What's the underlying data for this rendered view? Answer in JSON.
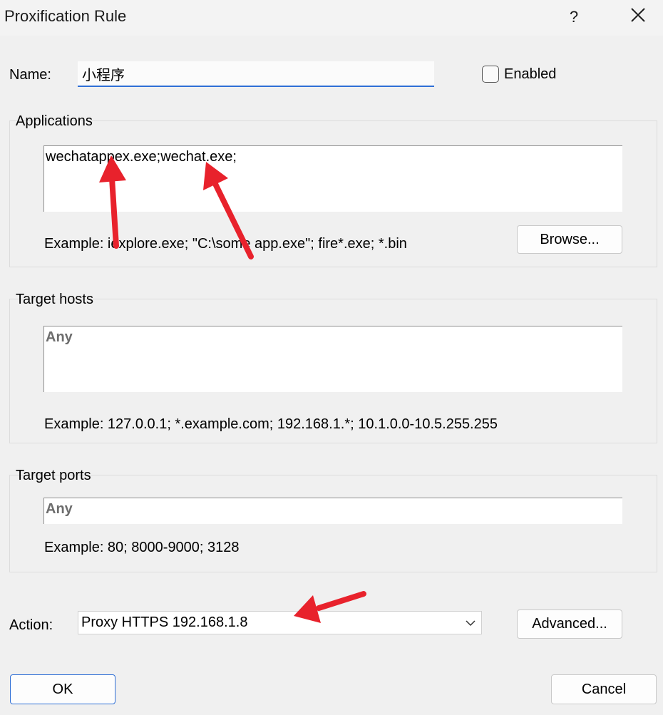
{
  "window": {
    "title": "Proxification Rule",
    "help_glyph": "?",
    "close_glyph": "✕"
  },
  "name": {
    "label": "Name:",
    "value": "小程序"
  },
  "enabled": {
    "label": "Enabled",
    "checked": false
  },
  "applications": {
    "title": "Applications",
    "value": "wechatappex.exe;wechat.exe;",
    "example": "Example: iexplore.exe; \"C:\\some app.exe\"; fire*.exe; *.bin",
    "browse_label": "Browse..."
  },
  "target_hosts": {
    "title": "Target hosts",
    "placeholder": "Any",
    "example": "Example: 127.0.0.1; *.example.com; 192.168.1.*; 10.1.0.0-10.5.255.255"
  },
  "target_ports": {
    "title": "Target ports",
    "placeholder": "Any",
    "example": "Example: 80; 8000-9000; 3128"
  },
  "action": {
    "label": "Action:",
    "selected": "Proxy HTTPS 192.168.1.8",
    "advanced_label": "Advanced..."
  },
  "footer": {
    "ok_label": "OK",
    "cancel_label": "Cancel"
  },
  "colors": {
    "annotation_arrow": "#e8222c",
    "focus_accent": "#2f6fd6"
  }
}
